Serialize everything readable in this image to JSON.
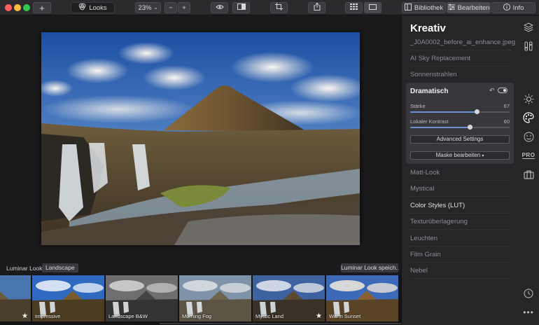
{
  "toolbar": {
    "looks_label": "Looks",
    "zoom_value": "23%",
    "library_label": "Bibliothek",
    "edit_label": "Bearbeiten",
    "info_label": "Info"
  },
  "panel": {
    "title": "Kreativ",
    "filename": "_J0A0002_before_ai_enhance.jpeg",
    "items_top": [
      "AI Sky Replacement",
      "Sonnenstrahlen"
    ],
    "dramatic": {
      "title": "Dramatisch",
      "slider_strength_label": "Stärke",
      "slider_strength_value": "67",
      "slider_contrast_label": "Lokaler Kontrast",
      "slider_contrast_value": "60",
      "advanced_label": "Advanced Settings",
      "mask_label": "Maske bearbeiten"
    },
    "items_bottom": [
      "Matt-Look",
      "Mystical",
      "Color Styles (LUT)",
      "Texturüberlagerung",
      "Leuchten",
      "Film Grain",
      "Nebel"
    ]
  },
  "looks_bar": {
    "label": "Luminar Looks:",
    "selected": "Landscape",
    "save_label": "Luminar Look speich..."
  },
  "filmstrip": [
    {
      "label": "ape",
      "star": true
    },
    {
      "label": "Impressive",
      "star": false
    },
    {
      "label": "Landscape B&W",
      "star": false
    },
    {
      "label": "Morning Fog",
      "star": false
    },
    {
      "label": "Mystic Land",
      "star": true
    },
    {
      "label": "Warm Sunset",
      "star": false
    }
  ],
  "icons": {
    "rail": [
      "layers-icon",
      "sliders-icon",
      "sun-icon",
      "palette-icon",
      "face-icon",
      "pro-icon",
      "briefcase-icon",
      "history-icon",
      "more-icon"
    ]
  },
  "colors": {
    "accent": "#6a8fd8",
    "panel_bg": "#262628",
    "card_bg": "#38383c"
  }
}
